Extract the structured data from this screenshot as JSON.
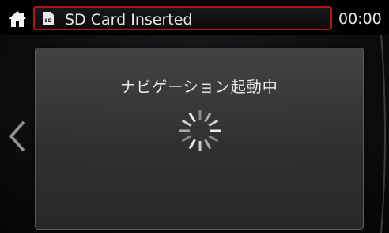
{
  "header": {
    "home_icon": "home-icon",
    "sd_icon_label": "SD",
    "title": "SD Card Inserted",
    "clock": "00:00",
    "title_border_color": "#b31414"
  },
  "navigation": {
    "back_icon": "chevron-left-icon"
  },
  "dialog": {
    "message": "ナビゲーション起動中",
    "spinner_icon": "loading-spinner-icon"
  }
}
